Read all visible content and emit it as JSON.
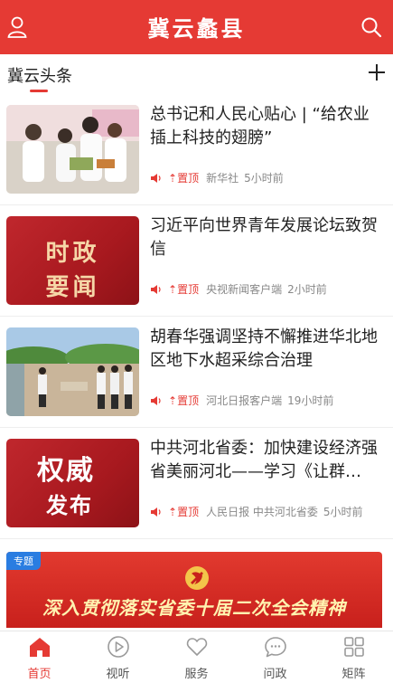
{
  "header": {
    "title": "冀云蠡县",
    "user_icon": "user-icon",
    "search_icon": "search-icon"
  },
  "section": {
    "title": "冀云头条",
    "add_icon": "plus-icon"
  },
  "colors": {
    "brand": "#e53a34",
    "tag_blue": "#2a7de1"
  },
  "news": [
    {
      "headline": "总书记和人民心贴心 | “给农业插上科技的翅膀”",
      "pin": "置顶",
      "source": "新华社",
      "time": "5小时前",
      "thumb": "photo-lab"
    },
    {
      "headline": "习近平向世界青年发展论坛致贺信",
      "pin": "置顶",
      "source": "央视新闻客户端",
      "time": "2小时前",
      "thumb": "red-card",
      "thumb_line1": "时政",
      "thumb_line2": "要闻"
    },
    {
      "headline": "胡春华强调坚持不懈推进华北地区地下水超采综合治理",
      "pin": "置顶",
      "source": "河北日报客户端",
      "time": "19小时前",
      "thumb": "photo-outdoor"
    },
    {
      "headline": "中共河北省委：加快建设经济强省美丽河北——学习《让群…",
      "pin": "置顶",
      "source": "人民日报 中共河北省委",
      "time": "5小时前",
      "thumb": "red-card",
      "thumb_line1": "权威",
      "thumb_line2": "发布"
    }
  ],
  "banner": {
    "tag": "专题",
    "text": "深入贯彻落实省委十届二次全会精神"
  },
  "tabs": [
    {
      "label": "首页",
      "icon": "home-icon",
      "active": true
    },
    {
      "label": "视听",
      "icon": "play-icon",
      "active": false
    },
    {
      "label": "服务",
      "icon": "heart-icon",
      "active": false
    },
    {
      "label": "问政",
      "icon": "chat-icon",
      "active": false
    },
    {
      "label": "矩阵",
      "icon": "grid-icon",
      "active": false
    }
  ]
}
